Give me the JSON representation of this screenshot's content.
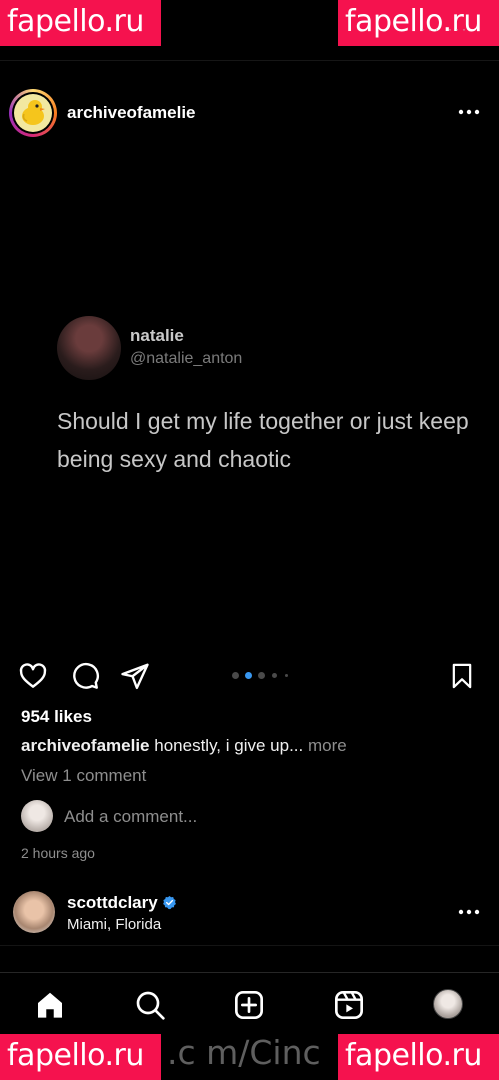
{
  "watermark": {
    "text": "fapello.ru",
    "color": "#f5124e"
  },
  "status_bar": {
    "left_fragment": "·",
    "right_fragment": "··· ···"
  },
  "post": {
    "username": "archiveofamelie",
    "more_icon": "more-horizontal-icon",
    "media": {
      "tweet": {
        "name": "natalie",
        "handle": "@natalie_anton",
        "text": "Should I get my life together or just keep being sexy and chaotic"
      },
      "carousel": {
        "count": 5,
        "active": 1
      }
    },
    "actions": [
      "heart-icon",
      "comment-icon",
      "share-icon",
      "bookmark-icon"
    ],
    "likes": "954 likes",
    "caption": {
      "user": "archiveofamelie",
      "text": "honestly, i give up...",
      "more": "more"
    },
    "view_comments": "View 1 comment",
    "add_comment_placeholder": "Add a comment...",
    "timestamp": "2 hours ago"
  },
  "next_post": {
    "username": "scottdclary",
    "location": "Miami, Florida",
    "verified": true,
    "accent": "#3897f0"
  },
  "nav": {
    "items": [
      "home-icon",
      "search-icon",
      "create-icon",
      "reels-icon",
      "profile-avatar"
    ],
    "notification_color": "#ff3040"
  },
  "url_ghost": ".c m/Cinc"
}
